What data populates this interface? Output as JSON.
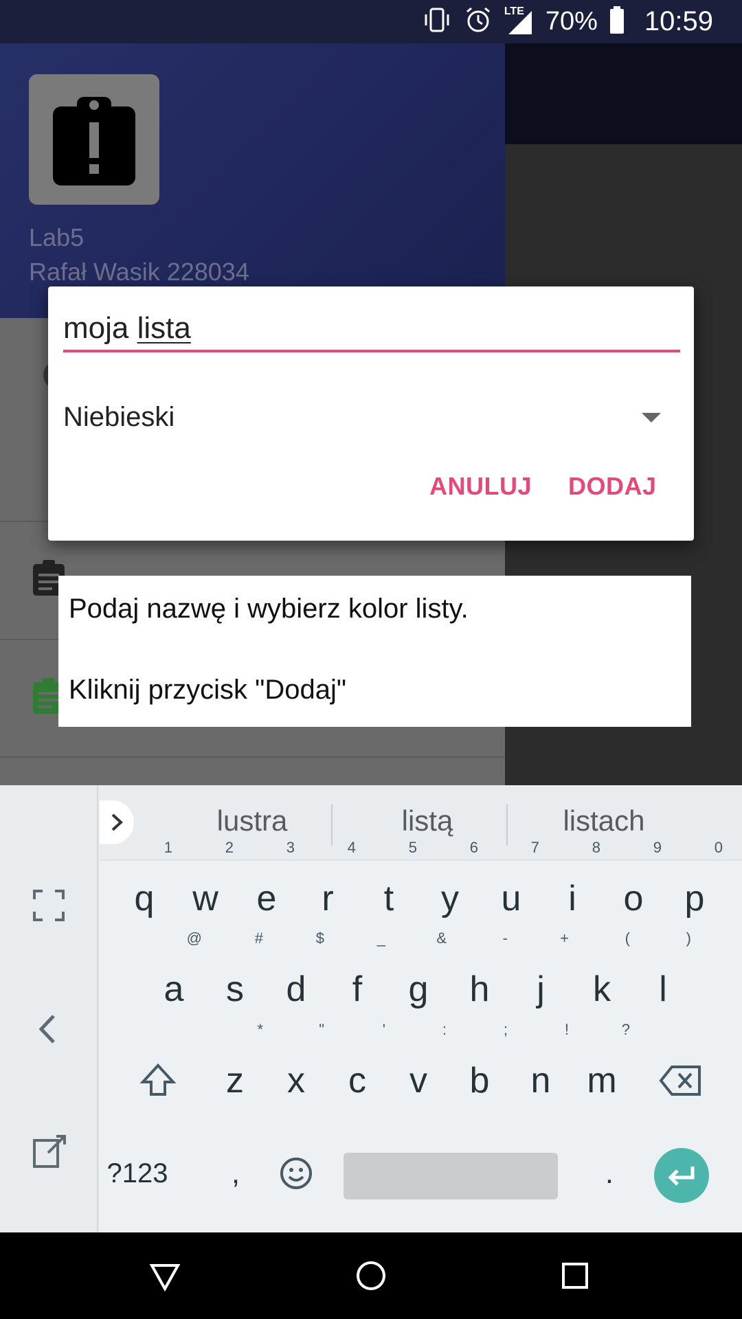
{
  "status": {
    "network": "LTE",
    "battery": "70%",
    "time": "10:59"
  },
  "drawer": {
    "app_name": "Lab5",
    "author": "Rafał Wasik 228034"
  },
  "dialog": {
    "name_value_word1": "moja",
    "name_value_word2": "lista",
    "color_selected": "Niebieski",
    "cancel_label": "ANULUJ",
    "add_label": "DODAJ",
    "accent_color": "#e4497a"
  },
  "hint": {
    "line1": "Podaj nazwę i wybierz kolor listy.",
    "line2": "Kliknij przycisk \"Dodaj\""
  },
  "keyboard": {
    "suggestions": [
      "lustra",
      "listą",
      "listach"
    ],
    "row1": [
      {
        "k": "q",
        "h": "1"
      },
      {
        "k": "w",
        "h": "2"
      },
      {
        "k": "e",
        "h": "3"
      },
      {
        "k": "r",
        "h": "4"
      },
      {
        "k": "t",
        "h": "5"
      },
      {
        "k": "y",
        "h": "6"
      },
      {
        "k": "u",
        "h": "7"
      },
      {
        "k": "i",
        "h": "8"
      },
      {
        "k": "o",
        "h": "9"
      },
      {
        "k": "p",
        "h": "0"
      }
    ],
    "row2": [
      {
        "k": "a",
        "h": "@"
      },
      {
        "k": "s",
        "h": "#"
      },
      {
        "k": "d",
        "h": "$"
      },
      {
        "k": "f",
        "h": "_"
      },
      {
        "k": "g",
        "h": "&"
      },
      {
        "k": "h",
        "h": "-"
      },
      {
        "k": "j",
        "h": "+"
      },
      {
        "k": "k",
        "h": "("
      },
      {
        "k": "l",
        "h": ")"
      }
    ],
    "row3": [
      {
        "k": "z",
        "h": "*"
      },
      {
        "k": "x",
        "h": "\""
      },
      {
        "k": "c",
        "h": "'"
      },
      {
        "k": "v",
        "h": ":"
      },
      {
        "k": "b",
        "h": ";"
      },
      {
        "k": "n",
        "h": "!"
      },
      {
        "k": "m",
        "h": "?"
      }
    ],
    "symbols_label": "?123",
    "comma_label": ",",
    "period_label": ".",
    "enter_color": "#4db6ac"
  }
}
